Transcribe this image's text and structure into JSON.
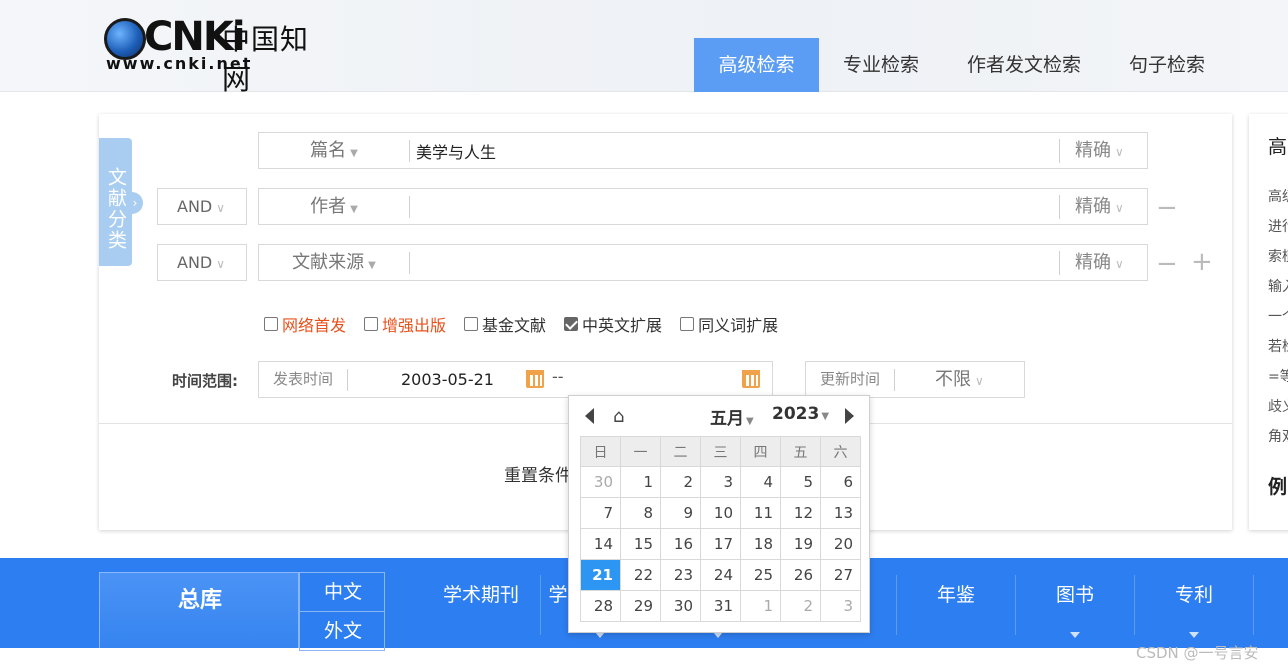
{
  "header": {
    "logo_brand": "CNKi",
    "logo_cn": "中国知网",
    "logo_url": "www.cnki.net",
    "tabs": [
      {
        "label": "高级检索",
        "active": true
      },
      {
        "label": "专业检索",
        "active": false
      },
      {
        "label": "作者发文检索",
        "active": false
      },
      {
        "label": "句子检索",
        "active": false
      }
    ]
  },
  "search": {
    "classify_tab": "文献分类",
    "rows": [
      {
        "logic": "",
        "field": "篇名",
        "value": "美学与人生",
        "match": "精确"
      },
      {
        "logic": "AND",
        "field": "作者",
        "value": "",
        "match": "精确"
      },
      {
        "logic": "AND",
        "field": "文献来源",
        "value": "",
        "match": "精确"
      }
    ],
    "remove_symbol": "−",
    "add_symbol": "+",
    "options": [
      {
        "label": "网络首发",
        "checked": false,
        "highlight": true
      },
      {
        "label": "增强出版",
        "checked": false,
        "highlight": true
      },
      {
        "label": "基金文献",
        "checked": false,
        "highlight": false
      },
      {
        "label": "中英文扩展",
        "checked": true,
        "highlight": false
      },
      {
        "label": "同义词扩展",
        "checked": false,
        "highlight": false
      }
    ],
    "time_range_label": "时间范围:",
    "publish_time_label": "发表时间",
    "date_from": "2003-05-21",
    "date_separator": "--",
    "date_to": "",
    "update_time_label": "更新时间",
    "update_time_value": "不限",
    "reset_label": "重置条件"
  },
  "side_panel": {
    "title": "高",
    "lines": [
      "高级",
      "进行",
      "索植",
      "输入",
      "一个",
      "若检",
      "=等",
      "歧义",
      "角双"
    ],
    "example": "例"
  },
  "calendar": {
    "month": "五月",
    "year": "2023",
    "weekdays": [
      "日",
      "一",
      "二",
      "三",
      "四",
      "五",
      "六"
    ],
    "weeks": [
      [
        "30",
        "1",
        "2",
        "3",
        "4",
        "5",
        "6"
      ],
      [
        "7",
        "8",
        "9",
        "10",
        "11",
        "12",
        "13"
      ],
      [
        "14",
        "15",
        "16",
        "17",
        "18",
        "19",
        "20"
      ],
      [
        "21",
        "22",
        "23",
        "24",
        "25",
        "26",
        "27"
      ],
      [
        "28",
        "29",
        "30",
        "31",
        "1",
        "2",
        "3"
      ]
    ],
    "selected": "21"
  },
  "databases": {
    "total_label": "总库",
    "total_sub": [
      "中文",
      "外文"
    ],
    "items": [
      "学术期刊",
      "学",
      "年鉴",
      "图书",
      "专利"
    ]
  },
  "watermark": "CSDN @一号言安",
  "colors": {
    "accent": "#5b9cf5",
    "db_bar": "#2d7ef0",
    "highlight_option": "#e8511c",
    "calendar_selected": "#2d96f2"
  }
}
